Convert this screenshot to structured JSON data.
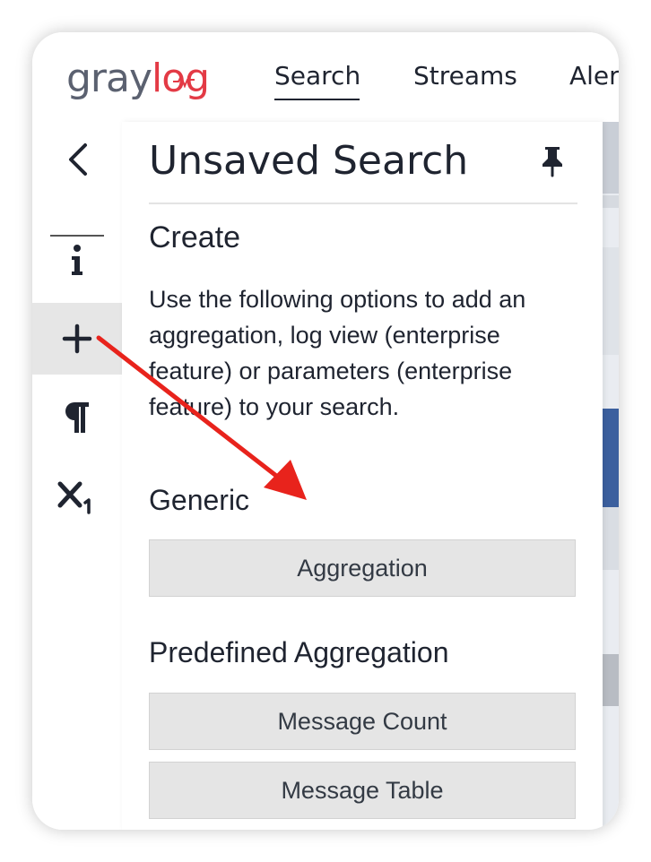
{
  "header": {
    "logo_left": "gray",
    "logo_right": "log",
    "nav": {
      "search": "Search",
      "streams": "Streams",
      "alerts": "Aler"
    }
  },
  "rail": {
    "items": [
      {
        "icon": "chevron-left-icon",
        "glyph": "<"
      },
      {
        "icon": "info-icon",
        "glyph": "i"
      },
      {
        "icon": "plus-icon",
        "glyph": "+"
      },
      {
        "icon": "paragraph-icon",
        "glyph": "¶"
      },
      {
        "icon": "subscript-icon",
        "glyph": "X",
        "sub": "1"
      }
    ],
    "active_index": 2
  },
  "panel": {
    "title": "Unsaved Search",
    "create_title": "Create",
    "create_description": "Use the following options to add an aggregation, log view (enterprise feature) or parameters (enterprise feature) to your search.",
    "generic_title": "Generic",
    "aggregation_button": "Aggregation",
    "predefined_title": "Predefined Aggregation",
    "message_count_button": "Message Count",
    "message_table_button": "Message Table"
  },
  "colors": {
    "brand_red": "#e33a45",
    "brand_gray": "#5b6170",
    "arrow_red": "#e8231c",
    "accent_blue": "#3b5f9e"
  }
}
